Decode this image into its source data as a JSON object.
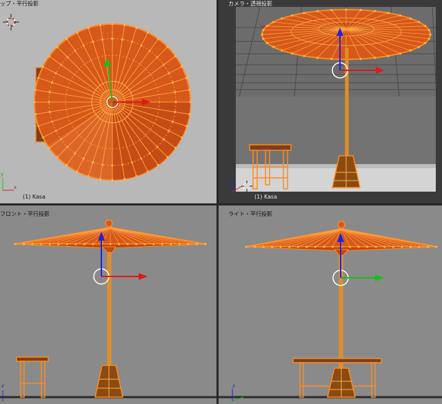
{
  "viewports": {
    "top": {
      "label": "ップ・平行投影",
      "object_label": "(1) Kasa",
      "axis_y": "y",
      "axis_x": "x"
    },
    "camera": {
      "label": "カメラ・透視投影",
      "object_label": "(1) Kasa"
    },
    "front": {
      "label": "フロント・平行投影",
      "axis_z": "z"
    },
    "right": {
      "label": "ライト・平行投影",
      "axis_z": "z"
    }
  },
  "colors": {
    "selection_orange": "#ff8a1e",
    "canopy_fill": "#d9601a",
    "canopy_dark": "#a8380c",
    "wire": "#ffb347",
    "axis_red": "#e01818",
    "axis_green": "#18c018",
    "axis_blue": "#2222dd",
    "ortho_bg": "#8c8c8c",
    "top_bg": "#b6b6b6",
    "camera_bg": "#6a6a6a"
  },
  "icons": {
    "cursor": "3d-cursor-icon",
    "pivot": "pivot-circle-icon"
  }
}
